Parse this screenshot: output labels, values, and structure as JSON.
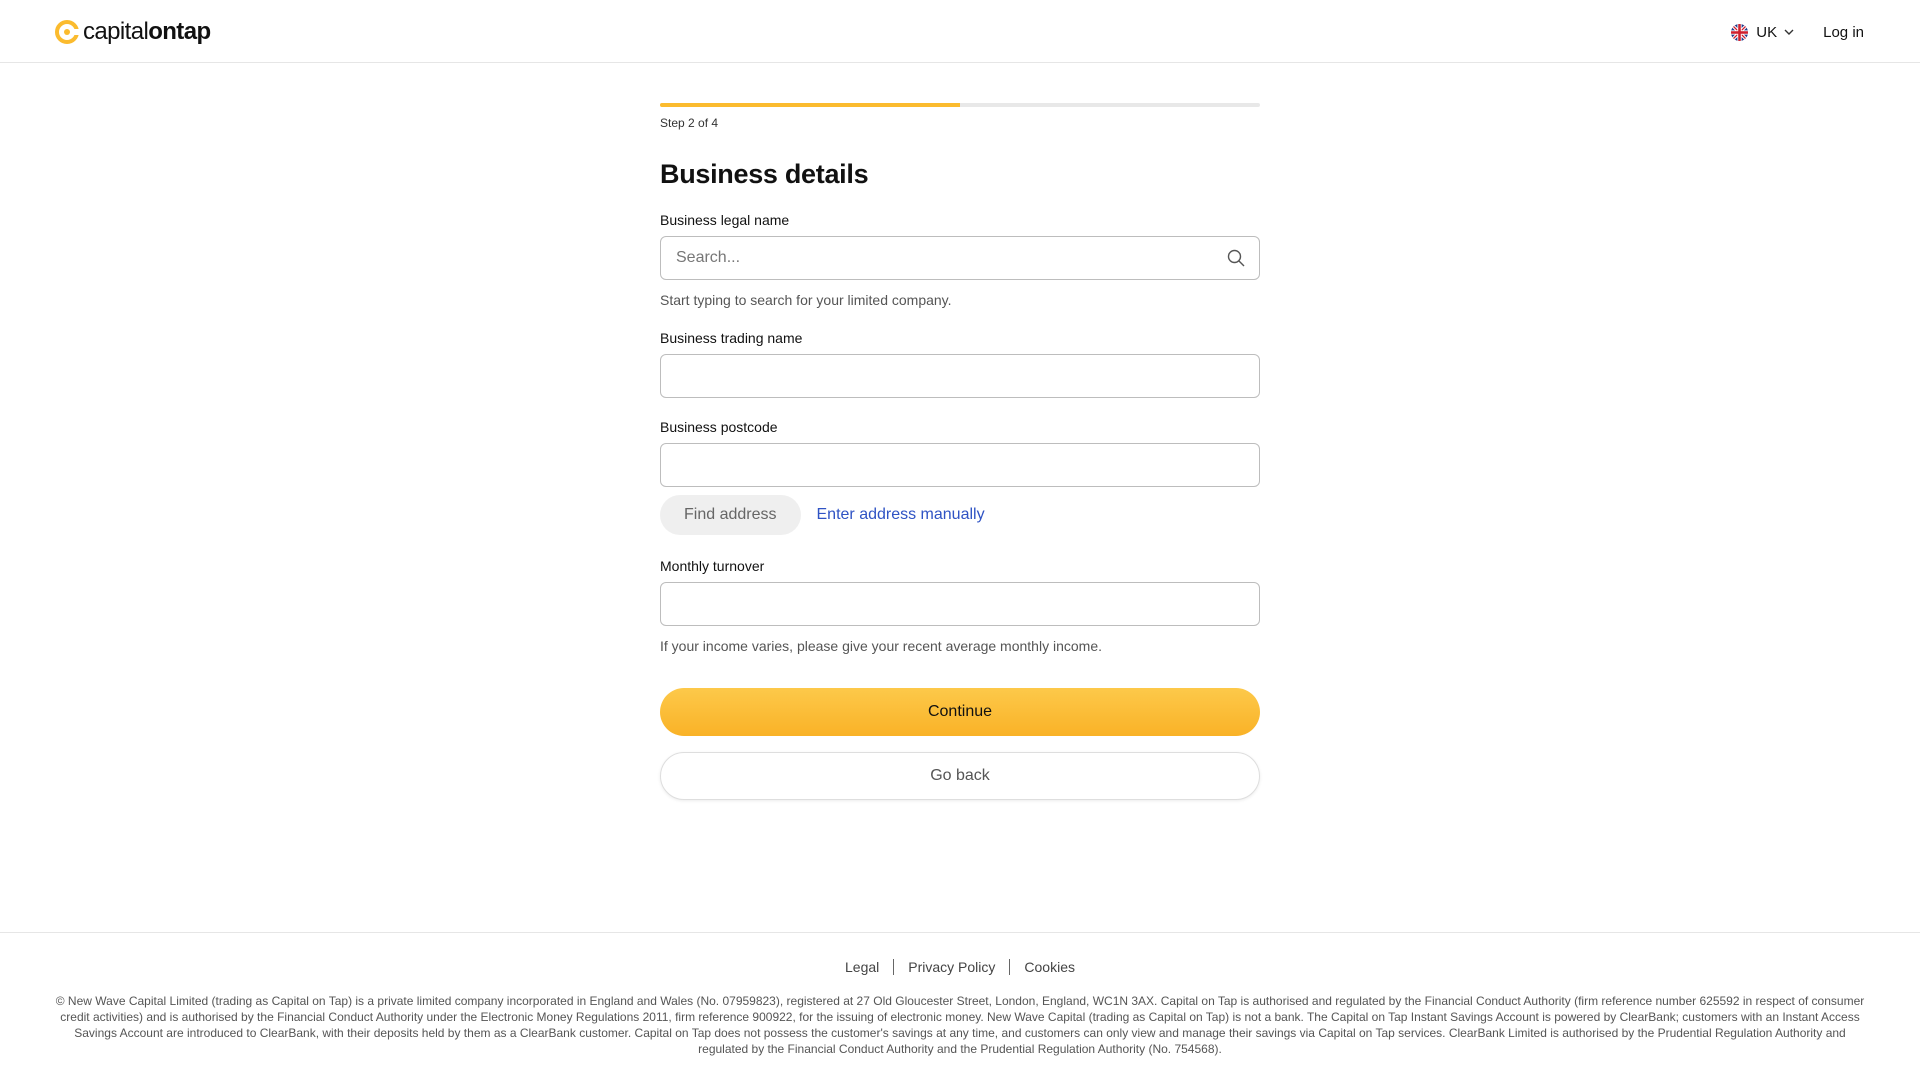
{
  "header": {
    "brand_part1": "capital",
    "brand_part2": "ontap",
    "region_label": "UK",
    "login_label": "Log in"
  },
  "progress": {
    "step_text": "Step 2 of 4",
    "current_step": 2,
    "total_steps": 4,
    "fill_fraction": 0.5
  },
  "form": {
    "title": "Business details",
    "legal_name": {
      "label": "Business legal name",
      "placeholder": "Search...",
      "value": "",
      "hint": "Start typing to search for your limited company."
    },
    "trading_name": {
      "label": "Business trading name",
      "value": ""
    },
    "postcode": {
      "label": "Business postcode",
      "value": "",
      "find_button": "Find address",
      "manual_link": "Enter address manually"
    },
    "turnover": {
      "label": "Monthly turnover",
      "value": "",
      "hint": "If your income varies, please give your recent average monthly income."
    },
    "continue_label": "Continue",
    "back_label": "Go back"
  },
  "footer": {
    "links": [
      "Legal",
      "Privacy Policy",
      "Cookies"
    ],
    "legal_text": "© New Wave Capital Limited (trading as Capital on Tap) is a private limited company incorporated in England and Wales (No. 07959823), registered at 27 Old Gloucester Street, London, England, WC1N 3AX. Capital on Tap is authorised and regulated by the Financial Conduct Authority (firm reference number 625592 in respect of consumer credit activities) and is authorised by the Financial Conduct Authority under the Electronic Money Regulations 2011, firm reference 900922, for the issuing of electronic money. New Wave Capital (trading as Capital on Tap) is not a bank. The Capital on Tap Instant Savings Account is powered by ClearBank; customers with an Instant Access Savings Account are introduced to ClearBank, with their deposits held by them as a ClearBank customer. Capital on Tap does not possess the customer's savings at any time, and customers can only view and manage their savings via Capital on Tap services. ClearBank Limited is authorised by the Prudential Regulation Authority and regulated by the Financial Conduct Authority and the Prudential Regulation Authority (No. 754568)."
  },
  "colors": {
    "accent": "#fbbb2e",
    "link": "#2f53c4",
    "border": "#bdbdbd"
  },
  "icons": {
    "logo": "capitalontap-logo-icon",
    "flag": "uk-flag-icon",
    "chevron": "chevron-down-icon",
    "search": "search-icon"
  }
}
